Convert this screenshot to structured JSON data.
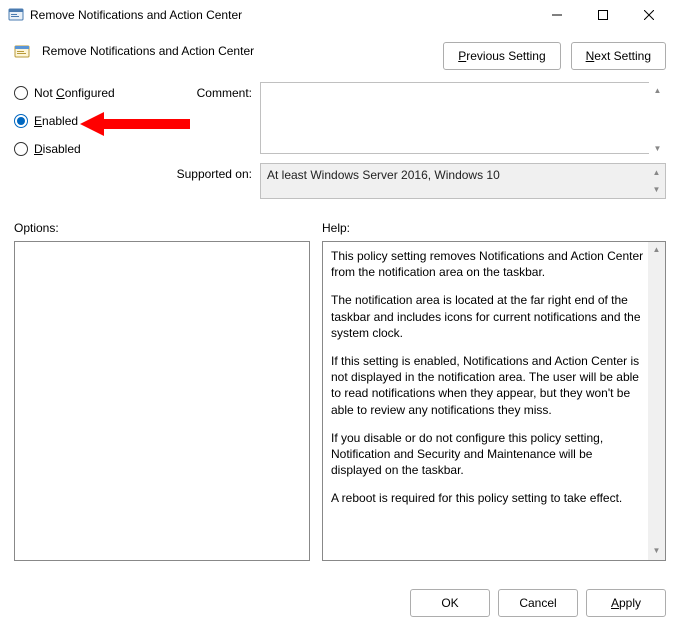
{
  "window": {
    "title": "Remove Notifications and Action Center"
  },
  "policy": {
    "title": "Remove Notifications and Action Center"
  },
  "nav": {
    "previous_label": "Previous Setting",
    "previous_accel": "P",
    "next_label": "Next Setting",
    "next_accel": "N"
  },
  "state": {
    "options": [
      {
        "id": "not-configured",
        "label": "Not Configured",
        "selected": false,
        "accel": "C"
      },
      {
        "id": "enabled",
        "label": "Enabled",
        "selected": true,
        "accel": "E"
      },
      {
        "id": "disabled",
        "label": "Disabled",
        "selected": false,
        "accel": "D"
      }
    ]
  },
  "labels": {
    "comment": "Comment:",
    "supported_on": "Supported on:",
    "options": "Options:",
    "help": "Help:"
  },
  "comment": {
    "value": ""
  },
  "supported_on": {
    "value": "At least Windows Server 2016, Windows 10"
  },
  "help": {
    "p1": "This policy setting removes Notifications and Action Center from the notification area on the taskbar.",
    "p2": "The notification area is located at the far right end of the taskbar and includes icons for current notifications and the system clock.",
    "p3": "If this setting is enabled, Notifications and Action Center is not displayed in the notification area. The user will be able to read notifications when they appear, but they won't be able to review any notifications they miss.",
    "p4": "If you disable or do not configure this policy setting, Notification and Security and Maintenance will be displayed on the taskbar.",
    "p5": "A reboot is required for this policy setting to take effect."
  },
  "footer": {
    "ok": "OK",
    "cancel": "Cancel",
    "apply": "Apply"
  },
  "annotation": {
    "color": "#ff0000",
    "points_to": "enabled-radio"
  }
}
